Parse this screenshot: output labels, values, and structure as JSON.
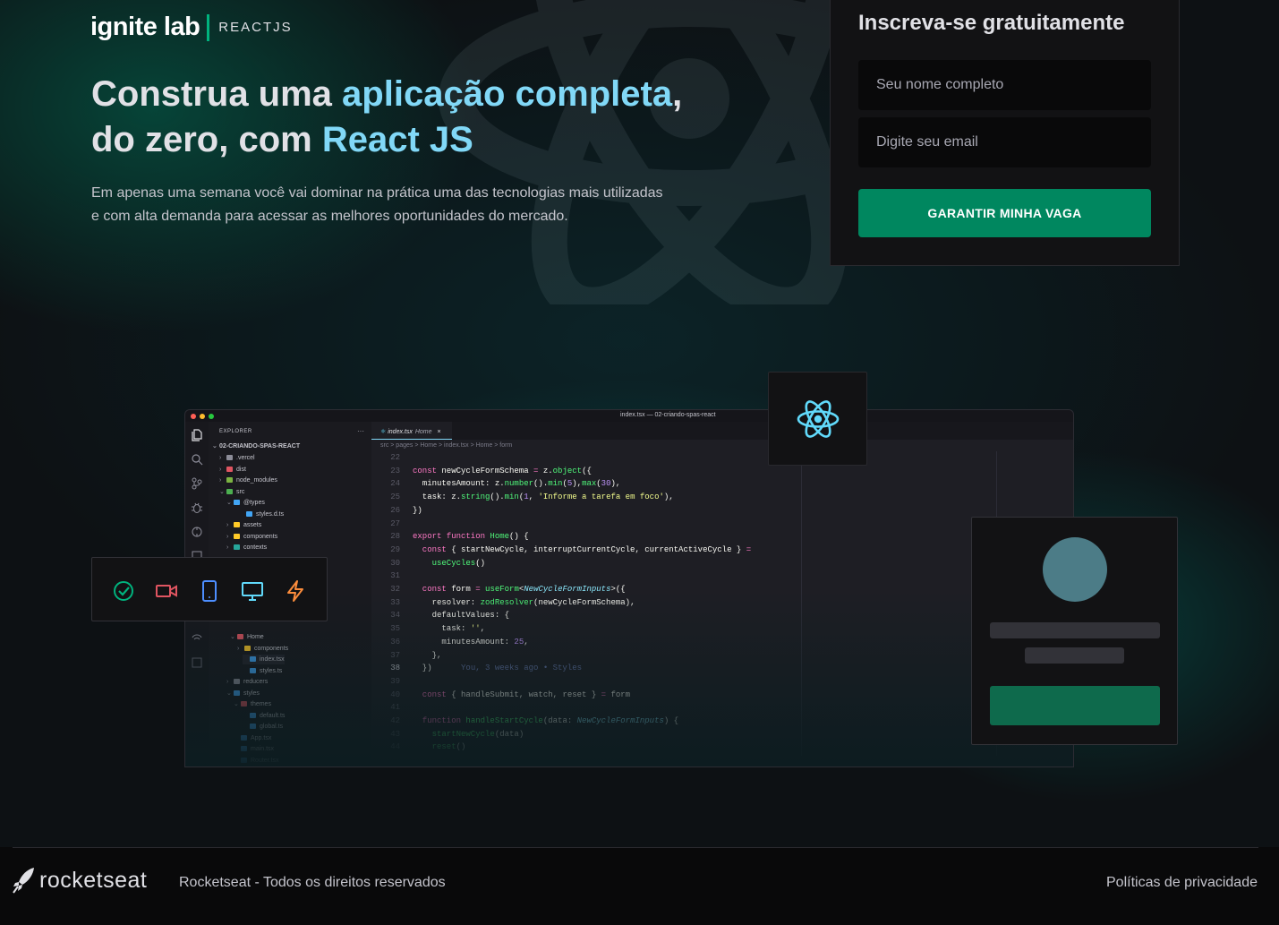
{
  "header": {
    "logo_word": "ignite lab",
    "logo_tag": "REACTJS"
  },
  "hero": {
    "headline_1": "Construa uma ",
    "headline_1_highlight": "aplicação completa",
    "headline_1_end": ",",
    "headline_2": "do zero, com ",
    "headline_2_highlight": "React JS",
    "subtext": "Em apenas uma semana você vai dominar na prática uma das tecnologias mais utilizadas e com alta demanda para acessar as melhores oportunidades do mercado."
  },
  "signup": {
    "title": "Inscreva-se gratuitamente",
    "name_placeholder": "Seu nome completo",
    "email_placeholder": "Digite seu email",
    "submit_label": "GARANTIR MINHA VAGA"
  },
  "editor": {
    "window_title": "index.tsx — 02-criando-spas-react",
    "explorer_title": "EXPLORER",
    "explorer_more": "···",
    "project_name": "02-CRIANDO-SPAS-REACT",
    "tab_file": "index.tsx",
    "tab_hint": "Home",
    "tab_close": "×",
    "breadcrumb": "src > pages > Home > index.tsx > Home > form",
    "tree": [
      {
        "label": ".vercel",
        "chev": "›",
        "color": "#8d8d99"
      },
      {
        "label": "dist",
        "chev": "›",
        "color": "#e05561"
      },
      {
        "label": "node_modules",
        "chev": "›",
        "color": "#7cb342"
      },
      {
        "label": "src",
        "chev": "⌄",
        "color": "#4caf50"
      },
      {
        "label": "@types",
        "chev": "⌄",
        "color": "#42a5f5"
      },
      {
        "label": "styles.d.ts",
        "chev": "",
        "color": "#42a5f5"
      },
      {
        "label": "assets",
        "chev": "›",
        "color": "#ffca28"
      },
      {
        "label": "components",
        "chev": "›",
        "color": "#ffca28"
      },
      {
        "label": "contexts",
        "chev": "›",
        "color": "#26a69a"
      },
      {
        "label": "Home",
        "chev": "⌄",
        "color": "#e05561"
      },
      {
        "label": "components",
        "chev": "›",
        "color": "#ffca28"
      },
      {
        "label": "index.tsx",
        "chev": "",
        "color": "#42a5f5"
      },
      {
        "label": "styles.ts",
        "chev": "",
        "color": "#42a5f5"
      },
      {
        "label": "reducers",
        "chev": "›",
        "color": "#8d8d99"
      },
      {
        "label": "styles",
        "chev": "⌄",
        "color": "#42a5f5"
      },
      {
        "label": "themes",
        "chev": "⌄",
        "color": "#e05561"
      },
      {
        "label": "default.ts",
        "chev": "",
        "color": "#42a5f5"
      },
      {
        "label": "global.ts",
        "chev": "",
        "color": "#42a5f5"
      },
      {
        "label": "App.tsx",
        "chev": "",
        "color": "#42a5f5"
      },
      {
        "label": "main.tsx",
        "chev": "",
        "color": "#42a5f5"
      },
      {
        "label": "Router.tsx",
        "chev": "",
        "color": "#42a5f5"
      }
    ],
    "lines": [
      {
        "n": "22",
        "tokens": []
      },
      {
        "n": "23",
        "tokens": [
          [
            "kw",
            "const "
          ],
          [
            "pl",
            "newCycleFormSchema "
          ],
          [
            "kw",
            "= "
          ],
          [
            "pl",
            "z."
          ],
          [
            "fn",
            "object"
          ],
          [
            "pl",
            "({"
          ]
        ]
      },
      {
        "n": "24",
        "tokens": [
          [
            "pl",
            "  minutesAmount: z."
          ],
          [
            "fn",
            "number"
          ],
          [
            "pl",
            "()."
          ],
          [
            "fn",
            "min"
          ],
          [
            "pl",
            "("
          ],
          [
            "num",
            "5"
          ],
          [
            "pl",
            "),"
          ],
          [
            "fn",
            "max"
          ],
          [
            "pl",
            "("
          ],
          [
            "num",
            "30"
          ],
          [
            "pl",
            "),"
          ]
        ]
      },
      {
        "n": "25",
        "tokens": [
          [
            "pl",
            "  task: z."
          ],
          [
            "fn",
            "string"
          ],
          [
            "pl",
            "()."
          ],
          [
            "fn",
            "min"
          ],
          [
            "pl",
            "("
          ],
          [
            "num",
            "1"
          ],
          [
            "pl",
            ", "
          ],
          [
            "str",
            "'Informe a tarefa em foco'"
          ],
          [
            "pl",
            "),"
          ]
        ]
      },
      {
        "n": "26",
        "tokens": [
          [
            "pl",
            "})"
          ]
        ]
      },
      {
        "n": "27",
        "tokens": []
      },
      {
        "n": "28",
        "tokens": [
          [
            "kw",
            "export function "
          ],
          [
            "fn",
            "Home"
          ],
          [
            "pl",
            "() {"
          ]
        ]
      },
      {
        "n": "29",
        "tokens": [
          [
            "kw",
            "  const "
          ],
          [
            "pl",
            "{ startNewCycle, interruptCurrentCycle, currentActiveCycle } "
          ],
          [
            "kw",
            "="
          ]
        ]
      },
      {
        "n": "30",
        "tokens": [
          [
            "fn",
            "    useCycles"
          ],
          [
            "pl",
            "()"
          ]
        ]
      },
      {
        "n": "31",
        "tokens": []
      },
      {
        "n": "32",
        "tokens": [
          [
            "kw",
            "  const "
          ],
          [
            "pl",
            "form "
          ],
          [
            "kw",
            "= "
          ],
          [
            "fn",
            "useForm"
          ],
          [
            "pl",
            "<"
          ],
          [
            "ty",
            "NewCycleFormInputs"
          ],
          [
            "pl",
            ">({"
          ]
        ]
      },
      {
        "n": "33",
        "tokens": [
          [
            "pl",
            "    resolver: "
          ],
          [
            "fn",
            "zodResolver"
          ],
          [
            "pl",
            "(newCycleFormSchema),"
          ]
        ]
      },
      {
        "n": "34",
        "tokens": [
          [
            "pl",
            "    defaultValues: {"
          ]
        ]
      },
      {
        "n": "35",
        "tokens": [
          [
            "pl",
            "      task: "
          ],
          [
            "str",
            "''"
          ],
          [
            "pl",
            ","
          ]
        ]
      },
      {
        "n": "36",
        "tokens": [
          [
            "pl",
            "      minutesAmount: "
          ],
          [
            "num",
            "25"
          ],
          [
            "pl",
            ","
          ]
        ]
      },
      {
        "n": "37",
        "tokens": [
          [
            "pl",
            "    },"
          ]
        ]
      },
      {
        "n": "38",
        "tokens": [
          [
            "pl",
            "  })"
          ],
          [
            "cm",
            "      You, 3 weeks ago • Styles"
          ]
        ],
        "current": true
      },
      {
        "n": "39",
        "tokens": []
      },
      {
        "n": "40",
        "tokens": [
          [
            "kw",
            "  const "
          ],
          [
            "pl",
            "{ handleSubmit, watch, reset } "
          ],
          [
            "kw",
            "= "
          ],
          [
            "pl",
            "form"
          ]
        ]
      },
      {
        "n": "41",
        "tokens": []
      },
      {
        "n": "42",
        "tokens": [
          [
            "kw",
            "  function "
          ],
          [
            "fn",
            "handleStartCycle"
          ],
          [
            "pl",
            "(data: "
          ],
          [
            "ty",
            "NewCycleFormInputs"
          ],
          [
            "pl",
            ") {"
          ]
        ]
      },
      {
        "n": "43",
        "tokens": [
          [
            "fn",
            "    startNewCycle"
          ],
          [
            "pl",
            "(data)"
          ]
        ]
      },
      {
        "n": "44",
        "tokens": [
          [
            "fn",
            "    reset"
          ],
          [
            "pl",
            "()"
          ]
        ]
      }
    ]
  },
  "toolbar": {
    "icons": [
      "check-circle-icon",
      "video-camera-icon",
      "tablet-icon",
      "monitor-icon",
      "lightning-icon"
    ]
  },
  "footer": {
    "brand": "rocketseat",
    "rights": "Rocketseat - Todos os direitos reservados",
    "privacy": "Políticas de privacidade"
  },
  "colors": {
    "accent_blue": "#81d8f7",
    "brand_green": "#00875f",
    "logo_bar_green": "#00b37e",
    "react_cyan": "#61dafb"
  }
}
